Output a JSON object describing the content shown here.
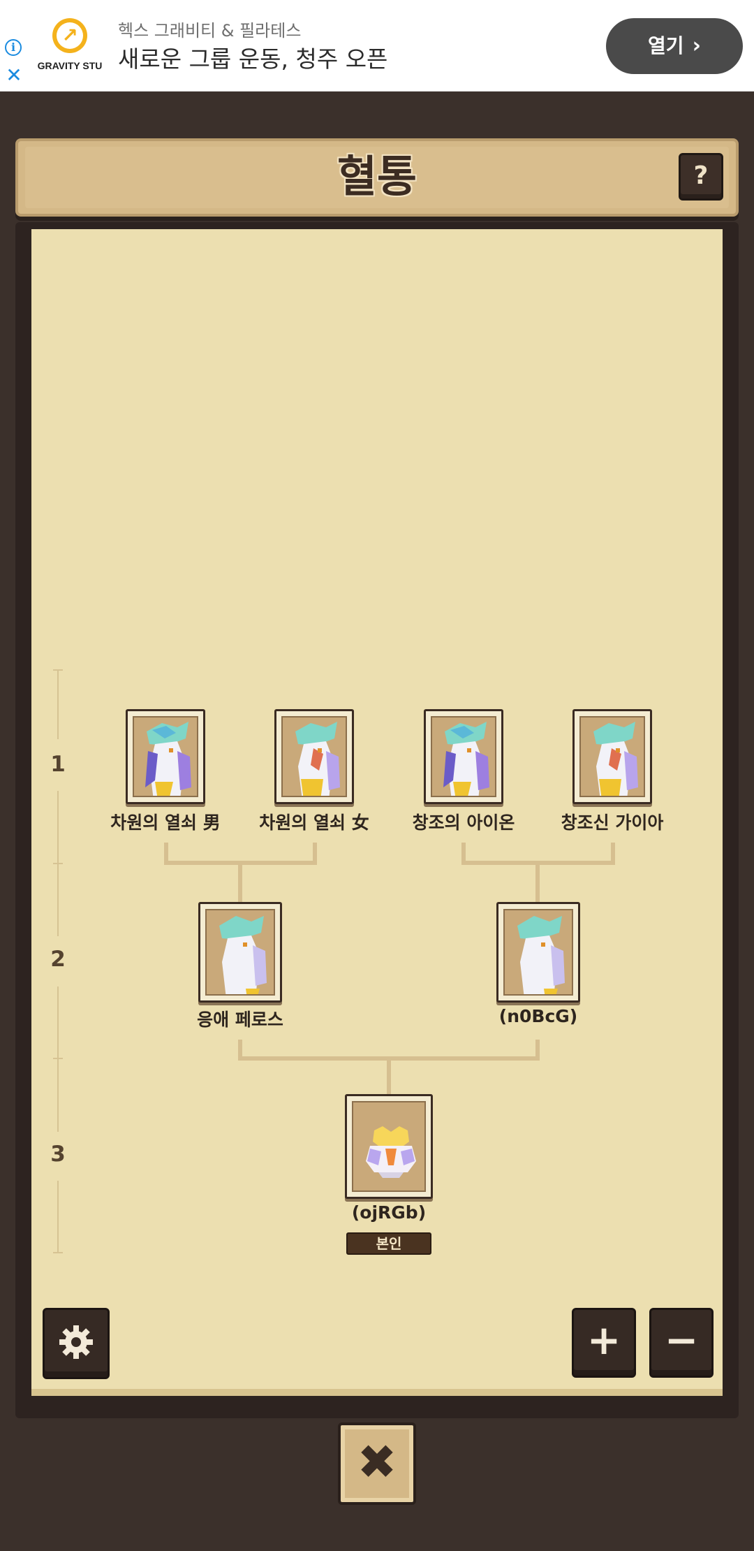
{
  "ad": {
    "info_icon": "info-icon",
    "close_icon": "close-icon",
    "brand": "GRAVITY STU",
    "subtitle": "헥스 그래비티 & 필라테스",
    "headline": "새로운 그룹 운동, 청주 오픈",
    "open_label": "열기",
    "open_chevron": "›"
  },
  "header": {
    "title": "혈통",
    "help_label": "?"
  },
  "generations": [
    {
      "label": "1"
    },
    {
      "label": "2"
    },
    {
      "label": "3"
    }
  ],
  "tree": {
    "gen1": [
      {
        "name": "차원의 열쇠 男",
        "icon": "dragon-portrait-icon"
      },
      {
        "name": "차원의 열쇠 女",
        "icon": "dragon-portrait-icon"
      },
      {
        "name": "창조의 아이온",
        "icon": "dragon-portrait-icon"
      },
      {
        "name": "창조신 가이아",
        "icon": "dragon-portrait-icon"
      }
    ],
    "gen2": [
      {
        "name": "응애 페로스",
        "icon": "dragon-portrait-icon"
      },
      {
        "name": "(n0BcG)",
        "icon": "dragon-portrait-icon"
      }
    ],
    "gen3": [
      {
        "name": "(ojRGb)",
        "icon": "egg-icon",
        "badge": "본인"
      }
    ]
  },
  "controls": {
    "settings_icon": "gear-icon",
    "zoom_in": "+",
    "zoom_out": "−",
    "close": "✖"
  },
  "colors": {
    "panel_bg": "#ecdfb0",
    "frame_dark": "#2d2320",
    "title_plate": "#d4b887",
    "ad_open_button": "#4a4a4a",
    "ad_accent": "#1a8be0"
  }
}
